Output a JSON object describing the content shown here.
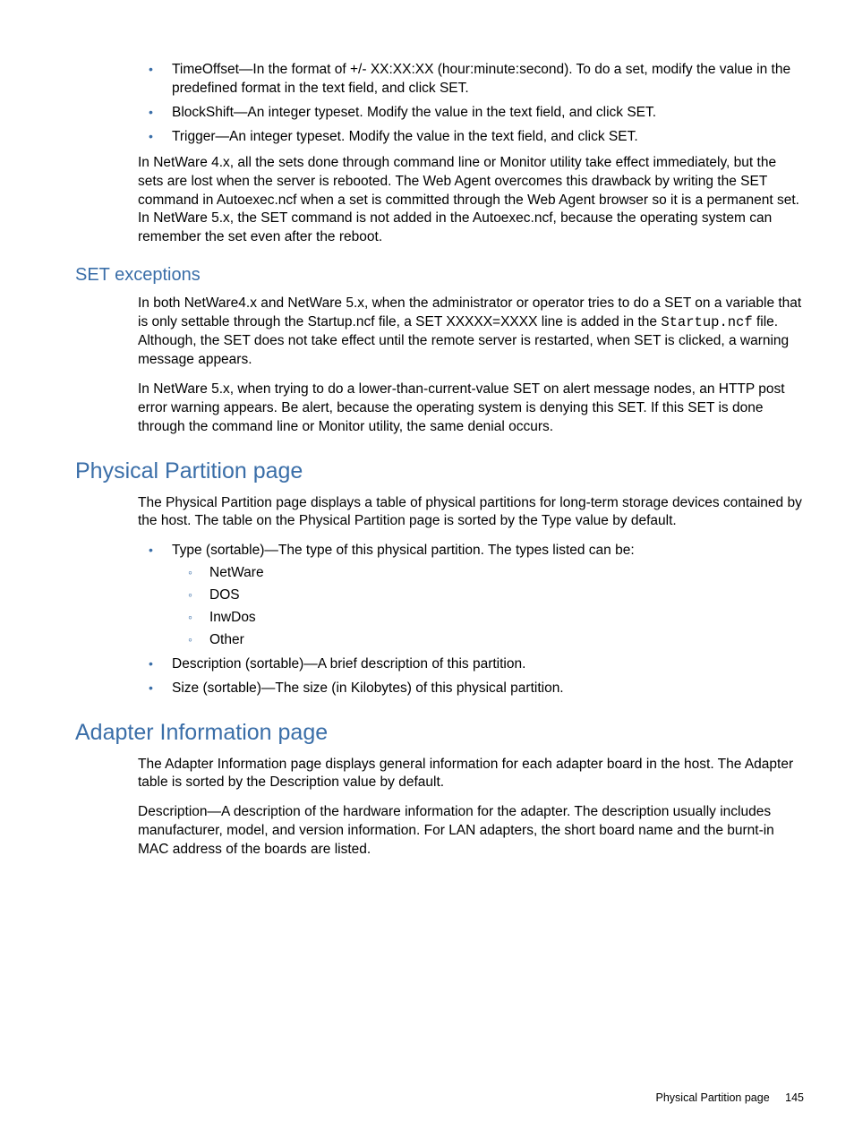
{
  "top_bullets": [
    "TimeOffset—In the format of +/- XX:XX:XX (hour:minute:second). To do a set, modify the value in the predefined format in the text field, and click SET.",
    "BlockShift—An integer typeset. Modify the value in the text field, and click SET.",
    "Trigger—An integer typeset. Modify the value in the text field, and click SET."
  ],
  "top_para": "In NetWare 4.x, all the sets done through command line or Monitor utility take effect immediately, but the sets are lost when the server is rebooted. The Web Agent overcomes this drawback by writing the SET command in Autoexec.ncf when a set is committed through the Web Agent browser so it is a permanent set. In NetWare 5.x, the SET command is not added in the Autoexec.ncf, because the operating system can remember the set even after the reboot.",
  "set_exceptions": {
    "heading": "SET exceptions",
    "p1_a": "In both NetWare4.x and NetWare 5.x, when the administrator or operator tries to do a SET on a variable that is only settable through the Startup.ncf file, a SET XXXXX=XXXX line is added in the ",
    "p1_mono": "Startup.ncf",
    "p1_b": " file. Although, the SET does not take effect until the remote server is restarted, when SET is clicked, a warning message appears.",
    "p2": "In NetWare 5.x, when trying to do a lower-than-current-value SET on alert message nodes, an HTTP post error warning appears. Be alert, because the operating system is denying this SET. If this SET is done through the command line or Monitor utility, the same denial occurs."
  },
  "physical_partition": {
    "heading": "Physical Partition page",
    "intro": "The Physical Partition page displays a table of physical partitions for long-term storage devices contained by the host. The table on the Physical Partition page is sorted by the Type value by default.",
    "type_label": "Type (sortable)—The type of this physical partition. The types listed can be:",
    "type_options": [
      "NetWare",
      "DOS",
      "InwDos",
      "Other"
    ],
    "desc_bullet": "Description (sortable)—A brief description of this partition.",
    "size_bullet": "Size (sortable)—The size (in Kilobytes) of this physical partition."
  },
  "adapter_info": {
    "heading": "Adapter Information page",
    "p1": "The Adapter Information page displays general information for each adapter board in the host. The Adapter table is sorted by the Description value by default.",
    "p2": "Description—A description of the hardware information for the adapter. The description usually includes manufacturer, model, and version information. For LAN adapters, the short board name and the burnt-in MAC address of the boards are listed."
  },
  "footer": {
    "title": "Physical Partition page",
    "page": "145"
  }
}
